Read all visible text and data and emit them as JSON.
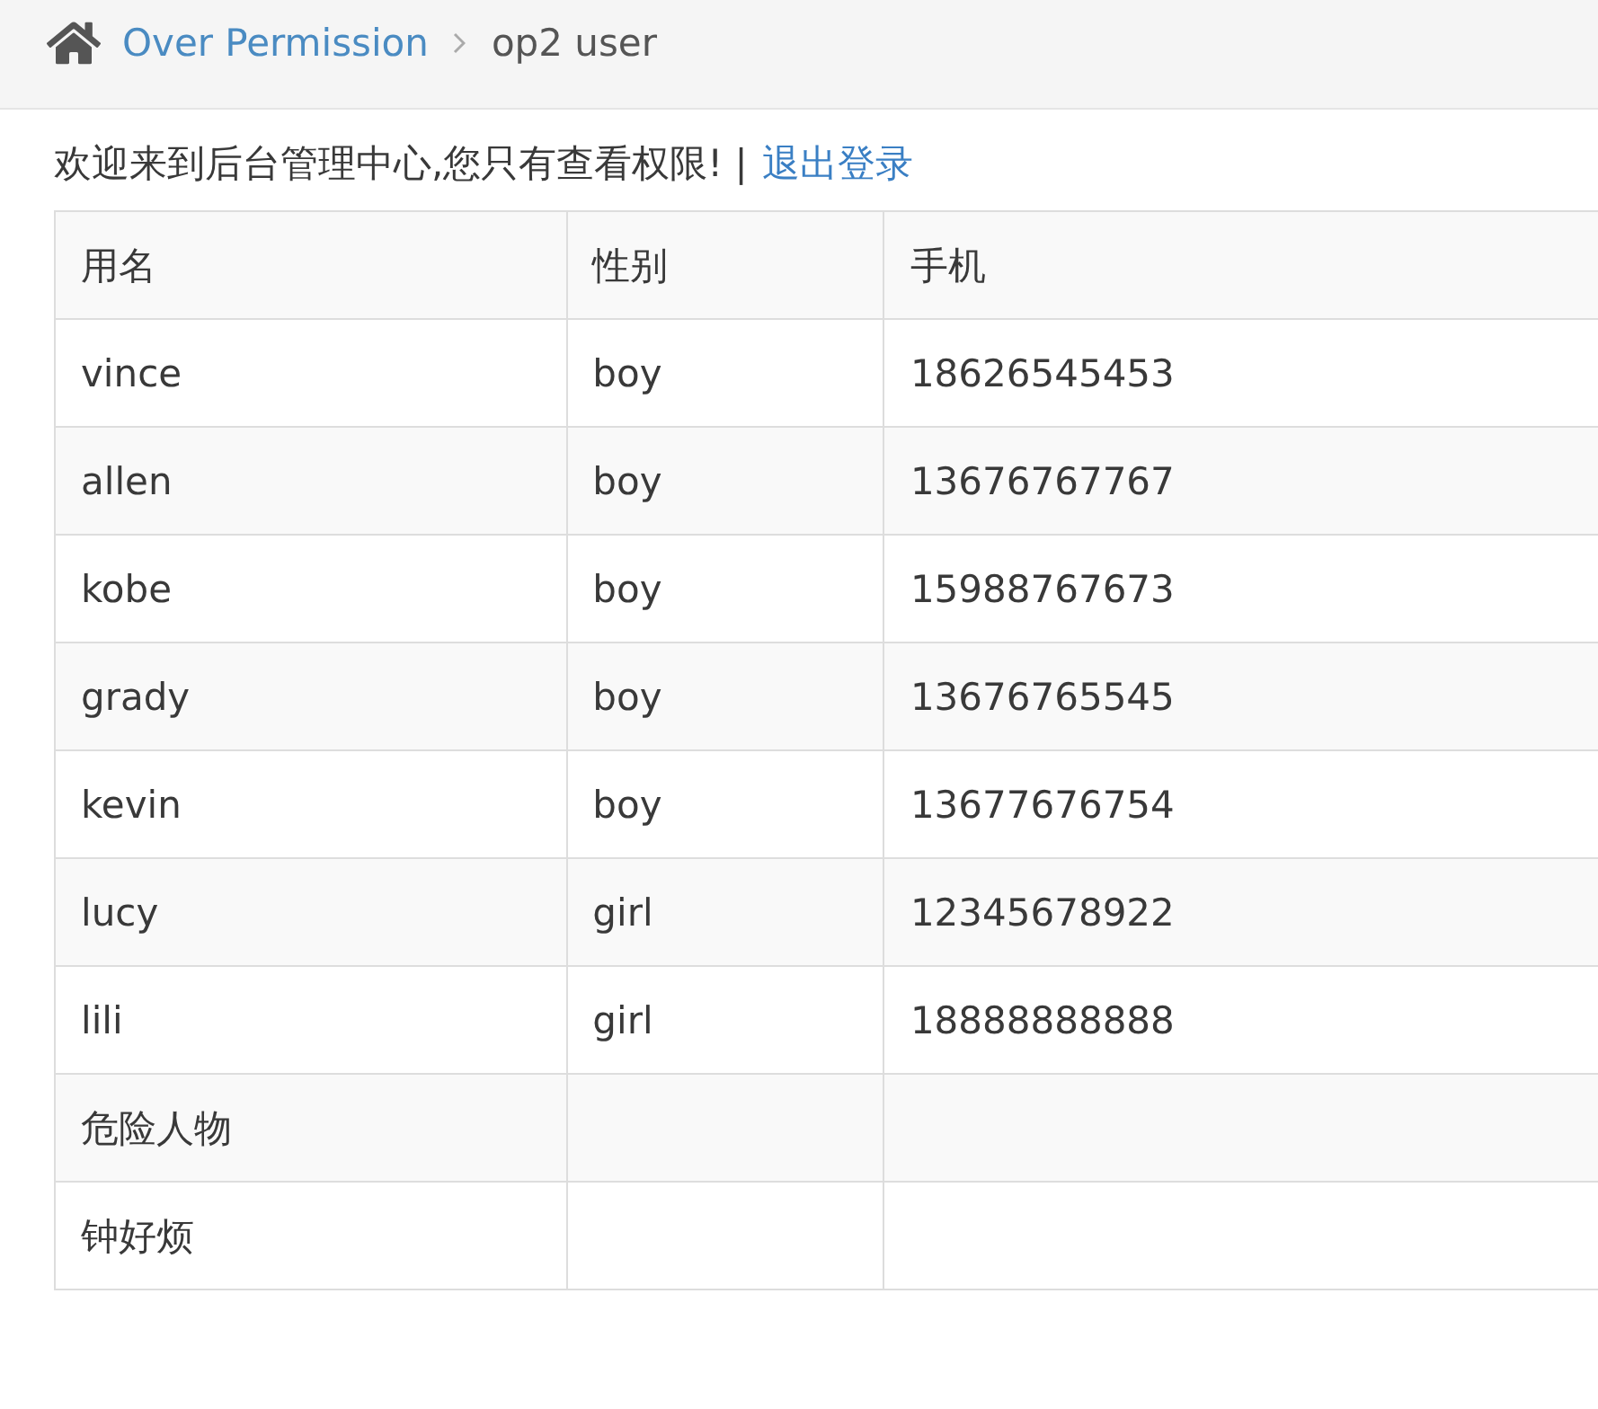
{
  "breadcrumb": [
    {
      "label": "Over Permission",
      "link": true
    },
    {
      "label": "op2 user",
      "link": false
    }
  ],
  "welcome": {
    "text": "欢迎来到后台管理中心,您只有查看权限! |",
    "link": "退出登录"
  },
  "table": {
    "columns": [
      "用名",
      "性别",
      "手机"
    ],
    "rows": [
      {
        "cells": [
          "vince",
          "boy",
          "18626545453"
        ]
      },
      {
        "cells": [
          "allen",
          "boy",
          "13676767767"
        ]
      },
      {
        "cells": [
          "kobe",
          "boy",
          "15988767673"
        ]
      },
      {
        "cells": [
          "grady",
          "boy",
          "13676765545"
        ]
      },
      {
        "cells": [
          "kevin",
          "boy",
          "13677676754"
        ]
      },
      {
        "cells": [
          "lucy",
          "girl",
          "12345678922"
        ]
      },
      {
        "cells": [
          "lili",
          "girl",
          "18888888888"
        ]
      },
      {
        "cells": [
          "危险人物"
        ]
      },
      {
        "cells": [
          "钟好烦"
        ]
      }
    ]
  }
}
